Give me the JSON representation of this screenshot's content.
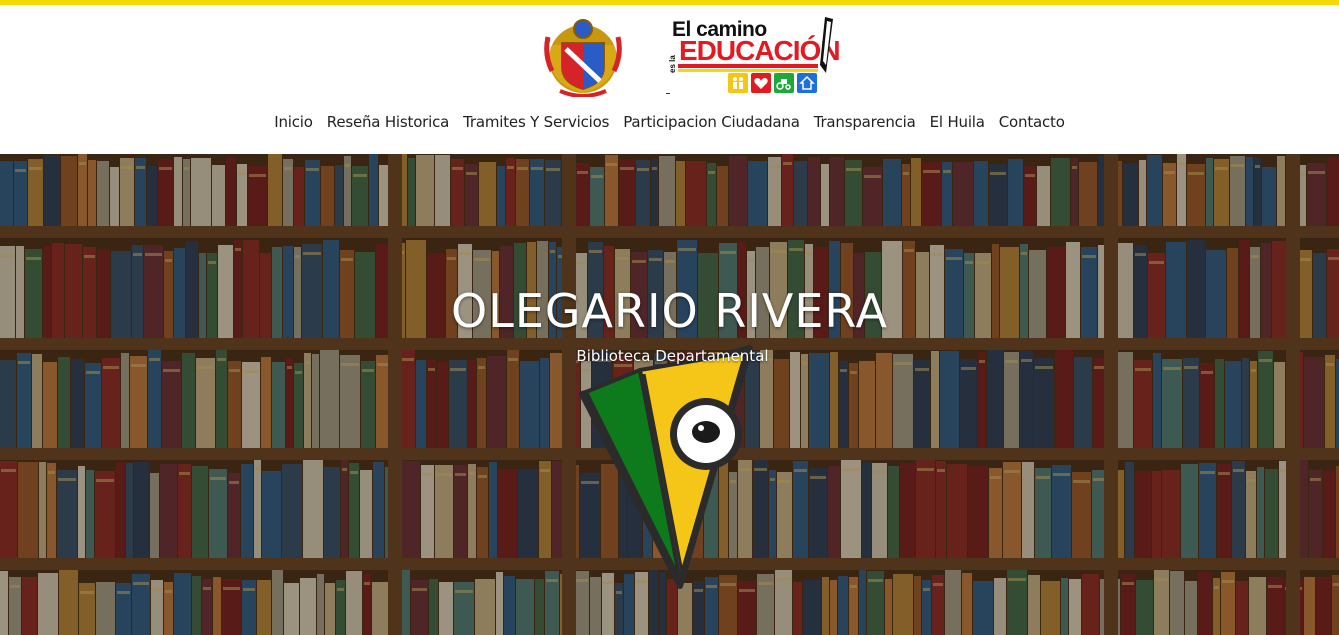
{
  "colors": {
    "topbar": "#f5d90b",
    "brand_red": "#e21b23",
    "logo_green": "#0d7a1c",
    "logo_yellow": "#f5c518"
  },
  "header": {
    "crest_icon": "coat-of-arms-icon",
    "campaign": {
      "line1": "El camino",
      "line2_small": "es la",
      "line2": "EDUCACIÓN",
      "icons": [
        "family-icon",
        "heart-icon",
        "tractor-icon",
        "house-icon"
      ]
    }
  },
  "nav": {
    "items": [
      {
        "label": "Inicio"
      },
      {
        "label": "Reseña Historica"
      },
      {
        "label": "Tramites Y Servicios"
      },
      {
        "label": "Participacion Ciudadana"
      },
      {
        "label": "Transparencia"
      },
      {
        "label": "El Huila"
      },
      {
        "label": "Contacto"
      }
    ]
  },
  "hero": {
    "title": "OLEGARIO RIVERA",
    "subtitle": "Biblioteca Departamental",
    "background": "bookshelf-image",
    "logo": "library-eye-logo-icon"
  }
}
